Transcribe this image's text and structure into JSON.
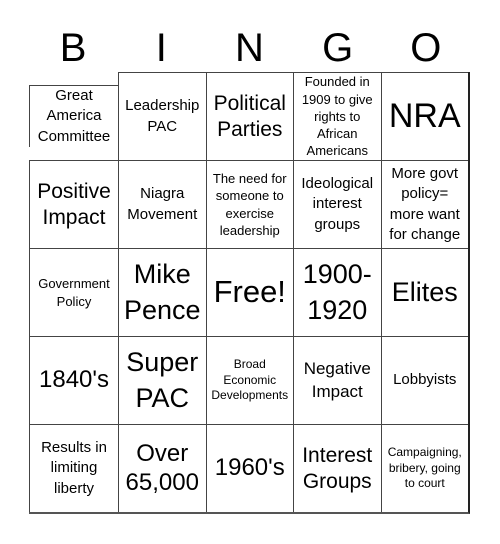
{
  "header": {
    "letters": [
      "B",
      "I",
      "N",
      "G",
      "O"
    ]
  },
  "cells": [
    [
      "Great America Committee",
      "Leadership PAC",
      "Political Parties",
      "Founded in 1909 to give rights to African Americans",
      "NRA"
    ],
    [
      "Positive Impact",
      "Niagra Movement",
      "The need for someone to exercise leadership",
      "Ideological interest groups",
      "More govt policy= more want for change"
    ],
    [
      "Government Policy",
      "Mike Pence",
      "Free!",
      "1900-1920",
      "Elites"
    ],
    [
      "1840's",
      "Super PAC",
      "Broad Economic Developments",
      "Negative Impact",
      "Lobbyists"
    ],
    [
      "Results in limiting liberty",
      "Over 65,000",
      "1960's",
      "Interest Groups",
      "Campaigning, bribery, going to court"
    ]
  ]
}
